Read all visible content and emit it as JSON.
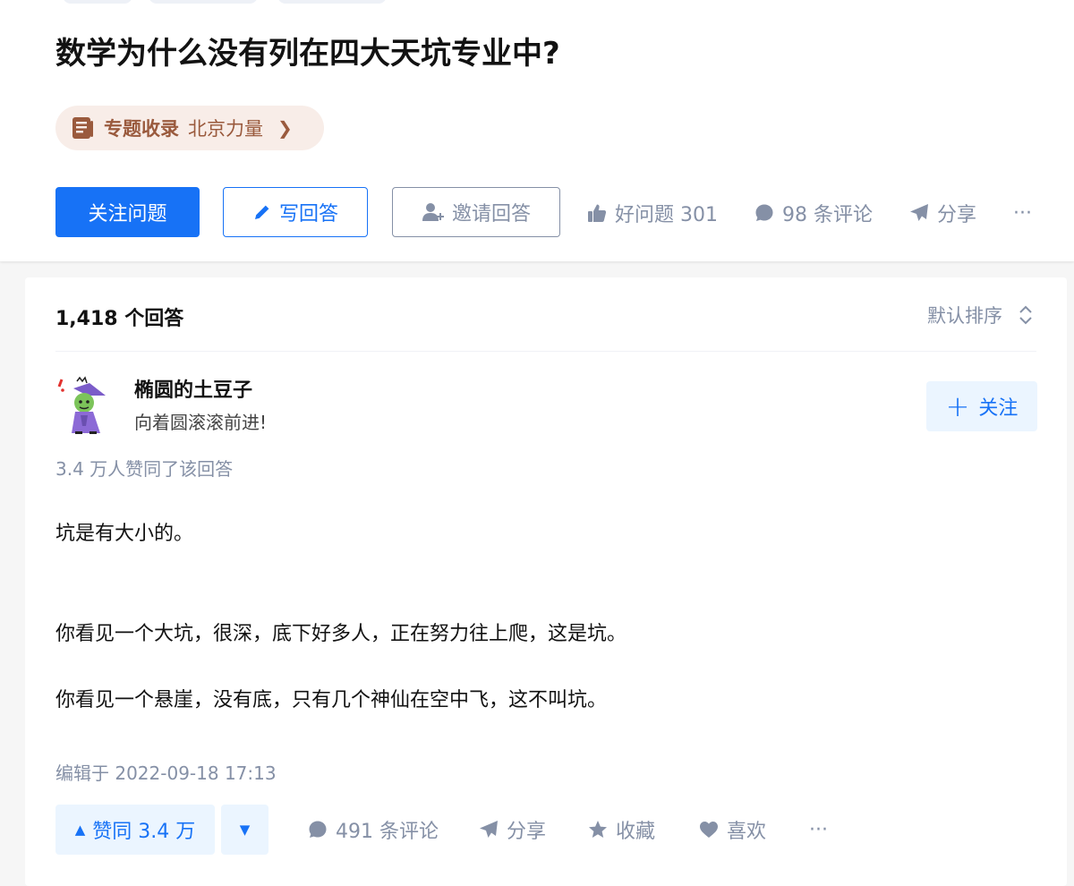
{
  "question": {
    "title": "数学为什么没有列在四大天坑专业中?",
    "collection": {
      "label": "专题收录",
      "name": "北京力量",
      "arrow": "❯"
    },
    "buttons": {
      "follow": "关注问题",
      "write": "写回答",
      "invite": "邀请回答"
    },
    "actions": {
      "good_question": "好问题 301",
      "comments": "98 条评论",
      "share": "分享",
      "more": "···"
    }
  },
  "answers": {
    "count_label": "1,418 个回答",
    "sort_label": "默认排序",
    "first": {
      "author_name": "椭圆的土豆子",
      "author_bio": "向着圆滚滚前进!",
      "follow_button": "关注",
      "follow_plus": "+",
      "votes_info": "3.4 万人赞同了该回答",
      "paragraphs": [
        "坑是有大小的。",
        "你看见一个大坑，很深，底下好多人，正在努力往上爬，这是坑。",
        "你看见一个悬崖，没有底，只有几个神仙在空中飞，这不叫坑。"
      ],
      "edit_time": "编辑于 2022-09-18 17:13",
      "vote_up": "赞同 3.4 万",
      "vote_up_icon": "▲",
      "vote_down_icon": "▼",
      "actions": {
        "comments": "491 条评论",
        "share": "分享",
        "collect": "收藏",
        "like": "喜欢",
        "more": "···"
      }
    }
  },
  "colors": {
    "brand_blue": "#1772f6",
    "muted_gray": "#8590a6",
    "collection_bg": "#f8ede8",
    "collection_text": "#9a5a3d",
    "light_blue_bg": "#ebf5ff"
  },
  "icons": {
    "collection": "book-list-icon",
    "write": "pencil-icon",
    "invite": "user-plus-icon",
    "good_question": "thumbs-up-icon",
    "comments": "comment-bubble-icon",
    "share": "paper-plane-icon",
    "sort": "sort-updown-icon",
    "collect": "star-icon",
    "like": "heart-icon"
  }
}
